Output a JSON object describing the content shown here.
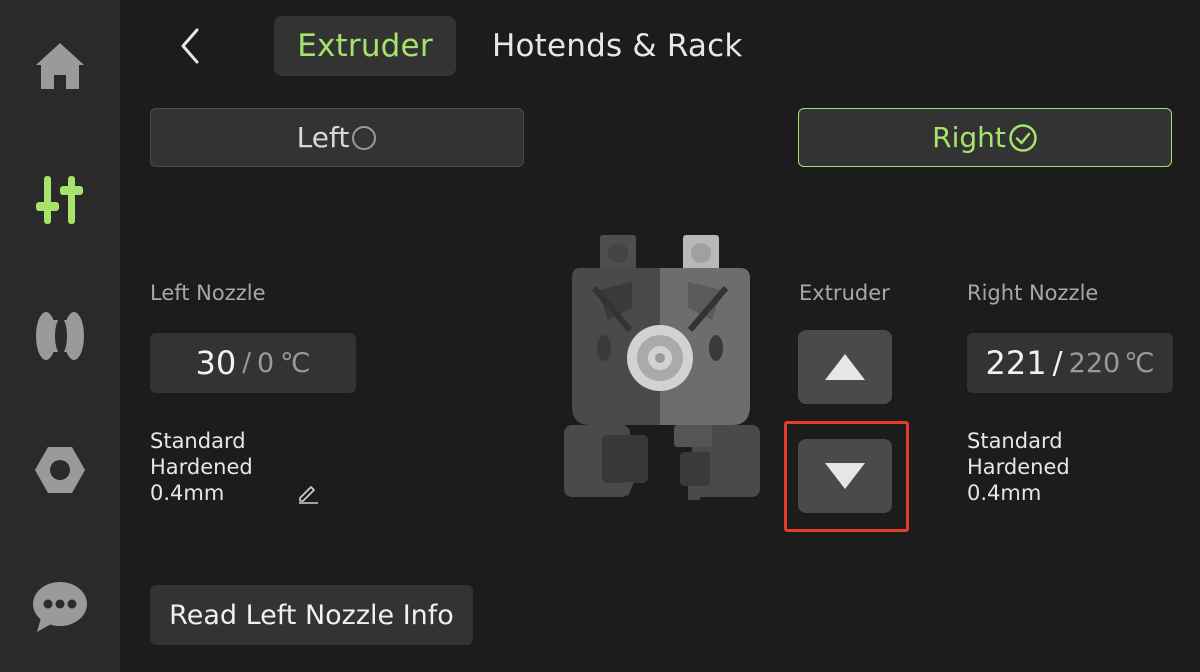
{
  "sidebar": {
    "items": [
      {
        "icon": "home-icon",
        "active": false
      },
      {
        "icon": "controls-icon",
        "active": true
      },
      {
        "icon": "filament-icon",
        "active": false
      },
      {
        "icon": "settings-nut-icon",
        "active": false
      },
      {
        "icon": "chat-icon",
        "active": false
      }
    ],
    "active_color": "#a6e36a",
    "icon_color": "#9a9a9a"
  },
  "header": {
    "tabs": [
      {
        "label": "Extruder",
        "active": true
      },
      {
        "label": "Hotends & Rack",
        "active": false
      }
    ]
  },
  "selector": {
    "left_label": "Left",
    "right_label": "Right",
    "selected": "Right"
  },
  "left_nozzle": {
    "title": "Left Nozzle",
    "current_temp": "30",
    "separator": "/",
    "target_temp": "0",
    "unit": "℃",
    "type": "Standard",
    "material": "Hardened",
    "size": "0.4mm"
  },
  "extruder": {
    "title": "Extruder"
  },
  "right_nozzle": {
    "title": "Right Nozzle",
    "current_temp": "221",
    "separator": "/",
    "target_temp": "220",
    "unit": "℃",
    "type": "Standard",
    "material": "Hardened",
    "size": "0.4mm"
  },
  "actions": {
    "read_info_label": "Read Left Nozzle Info"
  },
  "colors": {
    "accent": "#a6e36a",
    "highlight": "#e53b2b",
    "background": "#1c1c1c",
    "sidebar": "#2a2a2a"
  }
}
